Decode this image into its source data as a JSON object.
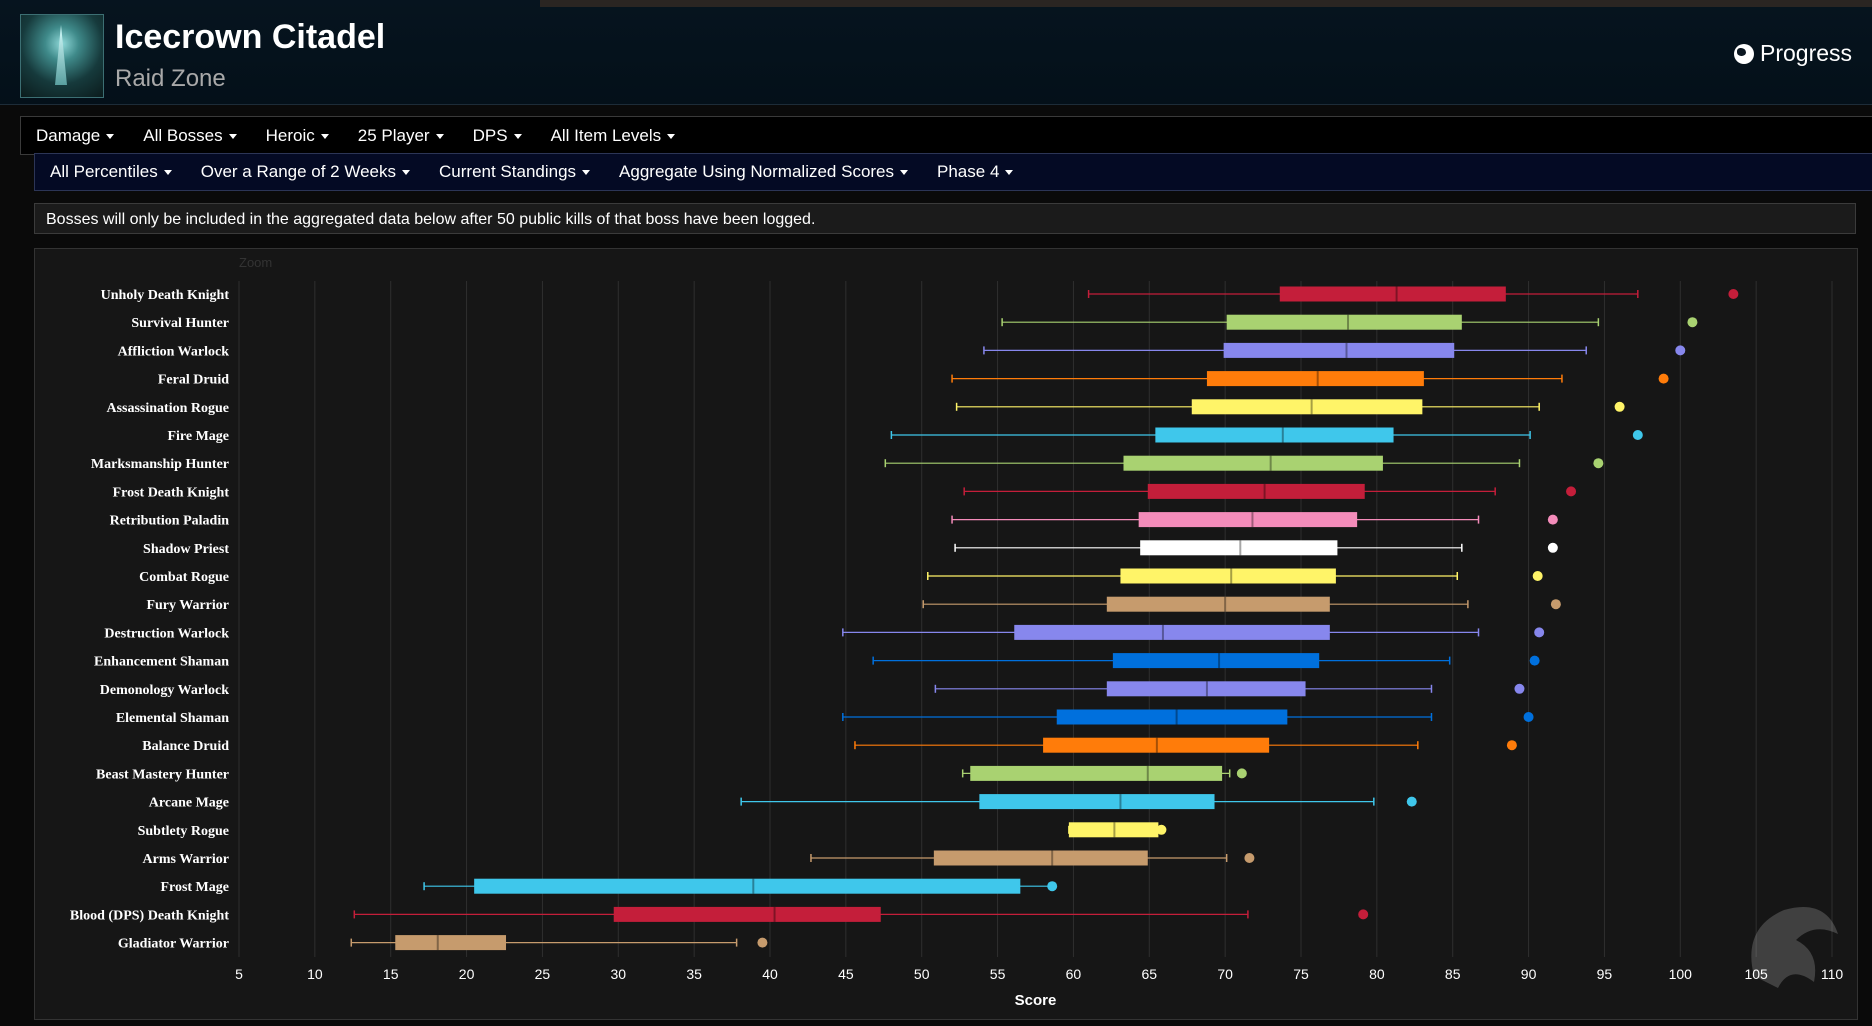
{
  "header": {
    "title": "Icecrown Citadel",
    "subtitle": "Raid Zone",
    "progress_label": "Progress",
    "zone_icon": "icecrown-citadel-zone-icon",
    "progress_icon": "globe-icon"
  },
  "filters_row1": [
    "Damage",
    "All Bosses",
    "Heroic",
    "25 Player",
    "DPS",
    "All Item Levels"
  ],
  "filters_row2": [
    "All Percentiles",
    "Over a Range of 2 Weeks",
    "Current Standings",
    "Aggregate Using Normalized Scores",
    "Phase 4"
  ],
  "notice": "Bosses will only be included in the aggregated data below after 50 public kills of that boss have been logged.",
  "chart_data": {
    "type": "boxplot",
    "title": "",
    "zoom_label": "Zoom",
    "xlabel": "Score",
    "xlim": [
      5,
      110
    ],
    "xticks": [
      5,
      10,
      15,
      20,
      25,
      30,
      35,
      40,
      45,
      50,
      55,
      60,
      65,
      70,
      75,
      80,
      85,
      90,
      95,
      100,
      105,
      110
    ],
    "grid": true,
    "series": [
      {
        "name": "Unholy Death Knight",
        "color": "#c41e3a",
        "min": 61,
        "q1": 73.6,
        "median": 81.3,
        "q3": 88.5,
        "max": 97.2,
        "outlier": 103.5
      },
      {
        "name": "Survival Hunter",
        "color": "#a9d271",
        "min": 55.3,
        "q1": 70.1,
        "median": 78.1,
        "q3": 85.6,
        "max": 94.6,
        "outlier": 100.8
      },
      {
        "name": "Affliction Warlock",
        "color": "#8787ed",
        "min": 54.1,
        "q1": 69.9,
        "median": 78,
        "q3": 85.1,
        "max": 93.8,
        "outlier": 100
      },
      {
        "name": "Feral Druid",
        "color": "#ff7c0a",
        "min": 52,
        "q1": 68.8,
        "median": 76.1,
        "q3": 83.1,
        "max": 92.2,
        "outlier": 98.9
      },
      {
        "name": "Assassination Rogue",
        "color": "#fff468",
        "min": 52.3,
        "q1": 67.8,
        "median": 75.7,
        "q3": 83,
        "max": 90.7,
        "outlier": 96
      },
      {
        "name": "Fire Mage",
        "color": "#3fc7eb",
        "min": 48,
        "q1": 65.4,
        "median": 73.8,
        "q3": 81.1,
        "max": 90.1,
        "outlier": 97.2
      },
      {
        "name": "Marksmanship Hunter",
        "color": "#a9d271",
        "min": 47.6,
        "q1": 63.3,
        "median": 73,
        "q3": 80.4,
        "max": 89.4,
        "outlier": 94.6
      },
      {
        "name": "Frost Death Knight",
        "color": "#c41e3a",
        "min": 52.8,
        "q1": 64.9,
        "median": 72.6,
        "q3": 79.2,
        "max": 87.8,
        "outlier": 92.8
      },
      {
        "name": "Retribution Paladin",
        "color": "#f48cba",
        "min": 52,
        "q1": 64.3,
        "median": 71.8,
        "q3": 78.7,
        "max": 86.7,
        "outlier": 91.6
      },
      {
        "name": "Shadow Priest",
        "color": "#ffffff",
        "min": 52.2,
        "q1": 64.4,
        "median": 71,
        "q3": 77.4,
        "max": 85.6,
        "outlier": 91.6
      },
      {
        "name": "Combat Rogue",
        "color": "#fff468",
        "min": 50.4,
        "q1": 63.1,
        "median": 70.4,
        "q3": 77.3,
        "max": 85.3,
        "outlier": 90.6
      },
      {
        "name": "Fury Warrior",
        "color": "#c69b6d",
        "min": 50.1,
        "q1": 62.2,
        "median": 70,
        "q3": 76.9,
        "max": 86,
        "outlier": 91.8
      },
      {
        "name": "Destruction Warlock",
        "color": "#8787ed",
        "min": 44.8,
        "q1": 56.1,
        "median": 65.9,
        "q3": 76.9,
        "max": 86.7,
        "outlier": 90.7
      },
      {
        "name": "Enhancement Shaman",
        "color": "#0070dd",
        "min": 46.8,
        "q1": 62.6,
        "median": 69.6,
        "q3": 76.2,
        "max": 84.8,
        "outlier": 90.4
      },
      {
        "name": "Demonology Warlock",
        "color": "#8787ed",
        "min": 50.9,
        "q1": 62.2,
        "median": 68.8,
        "q3": 75.3,
        "max": 83.6,
        "outlier": 89.4
      },
      {
        "name": "Elemental Shaman",
        "color": "#0070dd",
        "min": 44.8,
        "q1": 58.9,
        "median": 66.8,
        "q3": 74.1,
        "max": 83.6,
        "outlier": 90
      },
      {
        "name": "Balance Druid",
        "color": "#ff7c0a",
        "min": 45.6,
        "q1": 58,
        "median": 65.5,
        "q3": 72.9,
        "max": 82.7,
        "outlier": 88.9
      },
      {
        "name": "Beast Mastery Hunter",
        "color": "#a9d271",
        "min": 52.7,
        "q1": 53.2,
        "median": 64.9,
        "q3": 69.8,
        "max": 70.3,
        "outlier": 71.1
      },
      {
        "name": "Arcane Mage",
        "color": "#3fc7eb",
        "min": 38.1,
        "q1": 53.8,
        "median": 63.1,
        "q3": 69.3,
        "max": 79.8,
        "outlier": 82.3
      },
      {
        "name": "Subtlety Rogue",
        "color": "#fff468",
        "min": 59.7,
        "q1": 59.7,
        "median": 62.7,
        "q3": 65.6,
        "max": 65.7,
        "outlier": 65.8
      },
      {
        "name": "Arms Warrior",
        "color": "#c69b6d",
        "min": 42.7,
        "q1": 50.8,
        "median": 58.6,
        "q3": 64.9,
        "max": 70.1,
        "outlier": 71.6
      },
      {
        "name": "Frost Mage",
        "color": "#3fc7eb",
        "min": 17.2,
        "q1": 20.5,
        "median": 38.9,
        "q3": 56.5,
        "max": 58.5,
        "outlier": 58.6
      },
      {
        "name": "Blood (DPS) Death Knight",
        "color": "#c41e3a",
        "min": 12.6,
        "q1": 29.7,
        "median": 40.3,
        "q3": 47.3,
        "max": 71.5,
        "outlier": 79.1
      },
      {
        "name": "Gladiator Warrior",
        "color": "#c69b6d",
        "min": 12.4,
        "q1": 15.3,
        "median": 18.1,
        "q3": 22.6,
        "max": 37.8,
        "outlier": 39.5
      }
    ]
  },
  "watermark_icon": "warcraftlogs-logo-icon"
}
